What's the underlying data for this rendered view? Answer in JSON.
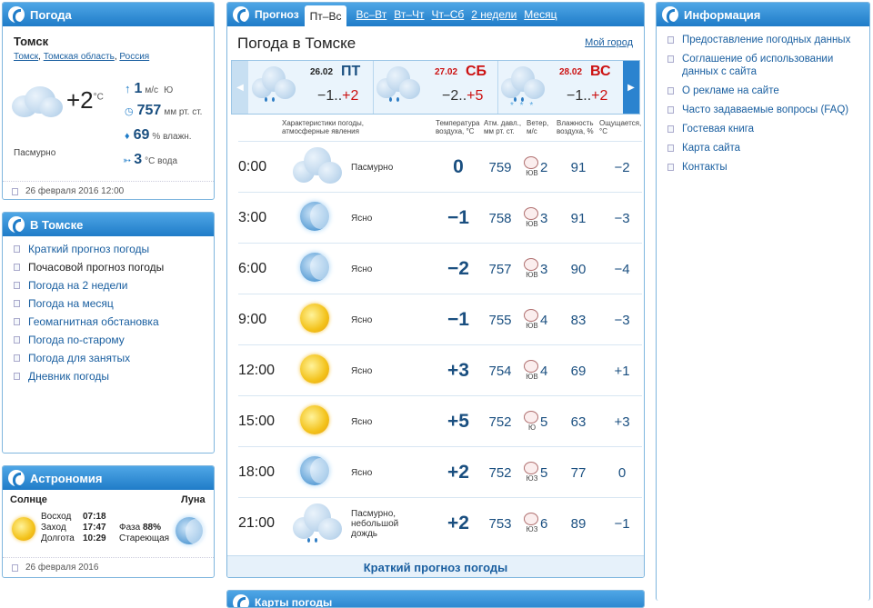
{
  "weather_panel": {
    "title": "Погода",
    "city": "Томск",
    "breadcrumbs": [
      "Томск",
      "Томская область",
      "Россия"
    ],
    "temp": "+2",
    "temp_unit": "°C",
    "wind_value": "1",
    "wind_unit": "м/с",
    "wind_dir": "Ю",
    "pressure_value": "757",
    "pressure_unit": "мм рт. ст.",
    "humidity_value": "69",
    "humidity_unit": "% влажн.",
    "water_value": "3",
    "water_unit": "°С вода",
    "condition": "Пасмурно",
    "date": "26 февраля 2016 12:00"
  },
  "in_tomsk": {
    "title": "В Томске",
    "items": [
      {
        "label": "Краткий прогноз погоды",
        "active": false
      },
      {
        "label": "Почасовой прогноз погоды",
        "active": true
      },
      {
        "label": "Погода на 2 недели",
        "active": false
      },
      {
        "label": "Погода на месяц",
        "active": false
      },
      {
        "label": "Геомагнитная обстановка",
        "active": false
      },
      {
        "label": "Погода по-старому",
        "active": false
      },
      {
        "label": "Погода для занятых",
        "active": false
      },
      {
        "label": "Дневник погоды",
        "active": false
      }
    ]
  },
  "astronomy": {
    "title": "Астрономия",
    "sun_label": "Солнце",
    "moon_label": "Луна",
    "sunrise_label": "Восход",
    "sunrise": "07:18",
    "sunset_label": "Заход",
    "sunset": "17:47",
    "length_label": "Долгота",
    "length": "10:29",
    "phase_label": "Фаза",
    "phase": "88%",
    "moon_state": "Стареющая",
    "date": "26 февраля 2016"
  },
  "forecast": {
    "header_title": "Прогноз",
    "tabs": [
      {
        "label": "Пт–Вс",
        "active": true
      },
      {
        "label": "Вс–Вт",
        "active": false
      },
      {
        "label": "Вт–Чт",
        "active": false
      },
      {
        "label": "Чт–Сб",
        "active": false
      },
      {
        "label": "2 недели",
        "active": false
      },
      {
        "label": "Месяц",
        "active": false
      }
    ],
    "page_title": "Погода в Томске",
    "my_city": "Мой город",
    "days": [
      {
        "date": "26.02",
        "dow": "ПТ",
        "range": "−1..",
        "max": "+2",
        "weekend": false
      },
      {
        "date": "27.02",
        "dow": "СБ",
        "range": "−2..",
        "max": "+5",
        "weekend": true
      },
      {
        "date": "28.02",
        "dow": "ВС",
        "range": "−1..",
        "max": "+2",
        "weekend": true
      }
    ],
    "col_headers": {
      "phenomena": "Характеристики погоды, атмосферные явления",
      "temp": "Температура воздуха, °С",
      "pressure": "Атм. давл., мм рт. ст.",
      "wind": "Ветер, м/с",
      "humidity": "Влажность воздуха, %",
      "feels": "Ощущается, °С"
    },
    "rows": [
      {
        "time": "0:00",
        "icon": "overcast-cloud-icon",
        "phen": "Пасмурно",
        "temp": "0",
        "pressure": "759",
        "wind_dir": "ЮВ",
        "wind": "2",
        "humidity": "91",
        "feels": "−2"
      },
      {
        "time": "3:00",
        "icon": "moon-icon",
        "phen": "Ясно",
        "temp": "−1",
        "pressure": "758",
        "wind_dir": "ЮВ",
        "wind": "3",
        "humidity": "91",
        "feels": "−3"
      },
      {
        "time": "6:00",
        "icon": "moon-icon",
        "phen": "Ясно",
        "temp": "−2",
        "pressure": "757",
        "wind_dir": "ЮВ",
        "wind": "3",
        "humidity": "90",
        "feels": "−4"
      },
      {
        "time": "9:00",
        "icon": "sun-icon",
        "phen": "Ясно",
        "temp": "−1",
        "pressure": "755",
        "wind_dir": "ЮВ",
        "wind": "4",
        "humidity": "83",
        "feels": "−3"
      },
      {
        "time": "12:00",
        "icon": "sun-icon",
        "phen": "Ясно",
        "temp": "+3",
        "pressure": "754",
        "wind_dir": "ЮВ",
        "wind": "4",
        "humidity": "69",
        "feels": "+1"
      },
      {
        "time": "15:00",
        "icon": "sun-icon",
        "phen": "Ясно",
        "temp": "+5",
        "pressure": "752",
        "wind_dir": "Ю",
        "wind": "5",
        "humidity": "63",
        "feels": "+3"
      },
      {
        "time": "18:00",
        "icon": "moon-icon",
        "phen": "Ясно",
        "temp": "+2",
        "pressure": "752",
        "wind_dir": "ЮЗ",
        "wind": "5",
        "humidity": "77",
        "feels": "0"
      },
      {
        "time": "21:00",
        "icon": "rain-cloud-icon",
        "phen": "Пасмурно, небольшой дождь",
        "temp": "+2",
        "pressure": "753",
        "wind_dir": "ЮЗ",
        "wind": "6",
        "humidity": "89",
        "feels": "−1"
      }
    ],
    "footer_link": "Краткий прогноз погоды",
    "next_panel_title": "Карты погоды"
  },
  "info": {
    "title": "Информация",
    "items": [
      "Предоставление погодных данных",
      "Соглашение об использовании данных с сайта",
      "О рекламе на сайте",
      "Часто задаваемые вопросы (FAQ)",
      "Гостевая книга",
      "Карта сайта",
      "Контакты"
    ]
  },
  "colors": {
    "accent": "#1f7cc8",
    "weekend": "#cc1111",
    "temp": "#1a4f80"
  }
}
